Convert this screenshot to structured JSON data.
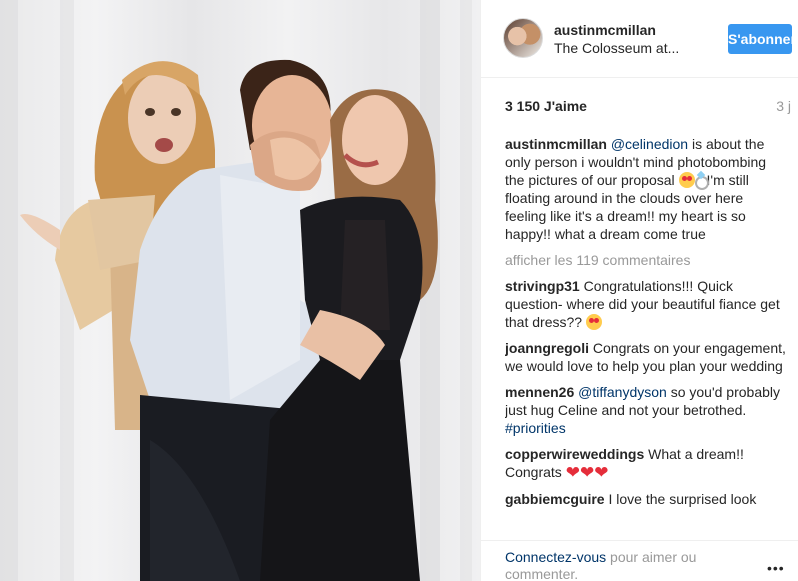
{
  "post": {
    "username": "austinmcmillan",
    "location": "The Colosseum at...",
    "follow_label": "S'abonner",
    "likes": "3 150 J'aime",
    "time_ago": "3 j"
  },
  "caption": {
    "username": "austinmcmillan",
    "mention": "@celinedion",
    "text_1": " is about the only person i wouldn't mind photobombing the pictures of our proposal ",
    "text_2": "I'm still floating around in the clouds over here feeling like it's a dream!! my heart is so happy!! what a dream come true"
  },
  "view_all_comments": "afficher les 119 commentaires",
  "comments": [
    {
      "username": "strivingp31",
      "text": "Congratulations!!! Quick question- where did your beautiful fiance get that dress?? "
    },
    {
      "username": "joanngregoli",
      "text": "Congrats on your engagement, we would love to help you plan your wedding"
    },
    {
      "username": "mennen26",
      "mention": "@tiffanydyson",
      "text": " so you'd probably just hug Celine and not your betrothed. ",
      "hashtag": "#priorities"
    },
    {
      "username": "copperwireweddings",
      "text": "What a dream!! Congrats "
    },
    {
      "username": "gabbiemcguire",
      "text": "I love the surprised look"
    }
  ],
  "footer": {
    "login_link": "Connectez-vous",
    "login_text": " pour aimer ou commenter.",
    "more": "•••"
  },
  "icons": {
    "heart_color": "#e52d3a",
    "follow_color": "#3897f0"
  }
}
